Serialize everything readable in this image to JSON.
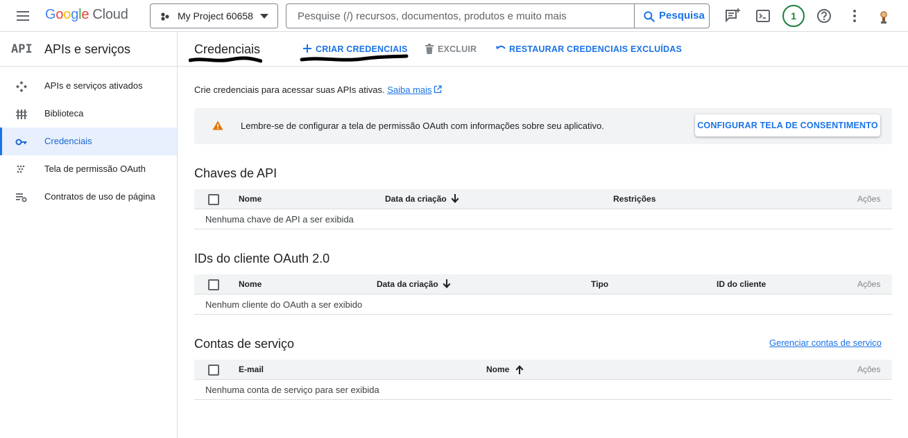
{
  "topbar": {
    "logo_letters": [
      "G",
      "o",
      "o",
      "g",
      "l",
      "e"
    ],
    "logo_suffix": "Cloud",
    "project_name": "My Project 60658",
    "search_placeholder": "Pesquise (/) recursos, documentos, produtos e muito mais",
    "search_button": "Pesquisa",
    "notification_count": "1",
    "icons": [
      "menu-icon",
      "project-dots-icon",
      "search-icon",
      "feedback-icon",
      "cloud-shell-icon",
      "help-icon",
      "more-vert-icon"
    ]
  },
  "sidebar": {
    "logo": "API",
    "title": "APIs e serviços",
    "items": [
      {
        "label": "APIs e serviços ativados",
        "icon": "apis-icon",
        "active": false
      },
      {
        "label": "Biblioteca",
        "icon": "library-icon",
        "active": false
      },
      {
        "label": "Credenciais",
        "icon": "key-icon",
        "active": true
      },
      {
        "label": "Tela de permissão OAuth",
        "icon": "oauth-dots-icon",
        "active": false
      },
      {
        "label": "Contratos de uso de página",
        "icon": "settings-list-icon",
        "active": false
      }
    ]
  },
  "header": {
    "title": "Credenciais",
    "actions": {
      "create": "CRIAR CREDENCIAIS",
      "delete": "EXCLUIR",
      "restore": "RESTAURAR CREDENCIAIS EXCLUÍDAS"
    }
  },
  "intro": {
    "text": "Crie credenciais para acessar suas APIs ativas.",
    "link": "Saiba mais"
  },
  "banner": {
    "message": "Lembre-se de configurar a tela de permissão OAuth com informações sobre seu aplicativo.",
    "button": "CONFIGURAR TELA DE CONSENTIMENTO"
  },
  "api_keys": {
    "title": "Chaves de API",
    "columns": [
      "Nome",
      "Data da criação",
      "Restrições",
      "Ações"
    ],
    "empty": "Nenhuma chave de API a ser exibida"
  },
  "oauth_clients": {
    "title": "IDs do cliente OAuth 2.0",
    "columns": [
      "Nome",
      "Data da criação",
      "Tipo",
      "ID do cliente",
      "Ações"
    ],
    "empty": "Nenhum cliente do OAuth a ser exibido"
  },
  "service_accounts": {
    "title": "Contas de serviço",
    "manage_link": "Gerenciar contas de serviço",
    "columns": [
      "E-mail",
      "Nome",
      "Ações"
    ],
    "empty": "Nenhuma conta de serviço para ser exibida"
  },
  "colors": {
    "accent": "#1a73e8",
    "warning": "#e37400",
    "badge": "#188038"
  }
}
